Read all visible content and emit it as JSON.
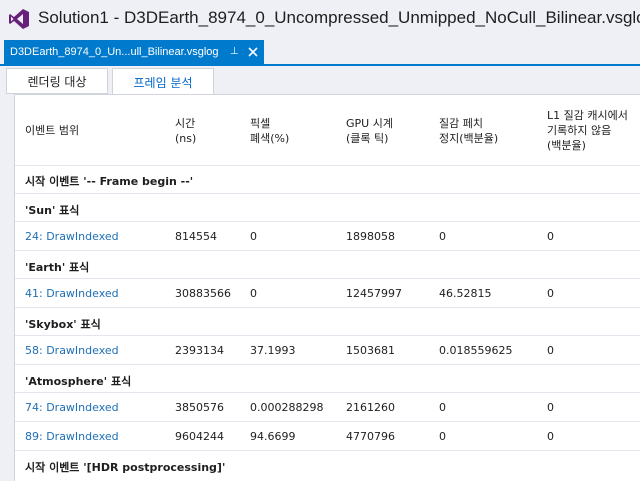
{
  "window": {
    "title": "Solution1 - D3DEarth_8974_0_Uncompressed_Unmipped_NoCull_Bilinear.vsglog"
  },
  "doc_tab": {
    "label": "D3DEarth_8974_0_Un...ull_Bilinear.vsglog",
    "pin_glyph": "⊥",
    "active_color": "#007acc"
  },
  "inner_tabs": [
    {
      "label": "렌더링 대상"
    },
    {
      "label": "프레임 분석"
    }
  ],
  "columns": {
    "event_range": "이벤트 범위",
    "time": [
      "시간",
      "(ns)"
    ],
    "pixels_culled": [
      "픽셀",
      "폐색(%)"
    ],
    "gpu_clock": [
      "GPU 시계",
      "(클록 틱)"
    ],
    "texture_stall": [
      "질감 페치",
      "정지(백분율)"
    ],
    "l1_cache_miss": [
      "L1 질감 캐시에서",
      "기록하지 않음",
      "(백분율)"
    ]
  },
  "rows": [
    {
      "kind": "group",
      "label": "시작 이벤트 '-- Frame begin --'"
    },
    {
      "kind": "group",
      "label": "'Sun' 표식"
    },
    {
      "kind": "data",
      "event": "24: DrawIndexed",
      "time": "814554",
      "culled": "0",
      "gpu": "1898058",
      "stall": "0",
      "l1": "0"
    },
    {
      "kind": "group",
      "label": "'Earth' 표식"
    },
    {
      "kind": "data",
      "event": "41: DrawIndexed",
      "time": "30883566",
      "culled": "0",
      "gpu": "12457997",
      "stall": "46.52815",
      "l1": "0"
    },
    {
      "kind": "group",
      "label": "'Skybox' 표식"
    },
    {
      "kind": "data",
      "event": "58: DrawIndexed",
      "time": "2393134",
      "culled": "37.1993",
      "gpu": "1503681",
      "stall": "0.018559625",
      "l1": "0"
    },
    {
      "kind": "group",
      "label": "'Atmosphere' 표식"
    },
    {
      "kind": "data",
      "event": "74: DrawIndexed",
      "time": "3850576",
      "culled": "0.000288298",
      "gpu": "2161260",
      "stall": "0",
      "l1": "0"
    },
    {
      "kind": "data",
      "event": "89: DrawIndexed",
      "time": "9604244",
      "culled": "94.6699",
      "gpu": "4770796",
      "stall": "0",
      "l1": "0"
    },
    {
      "kind": "group",
      "label": "시작 이벤트 '[HDR postprocessing]'"
    }
  ],
  "icons": {
    "logo": "visual-studio-logo-icon",
    "pin": "pin-icon",
    "close": "close-icon"
  }
}
